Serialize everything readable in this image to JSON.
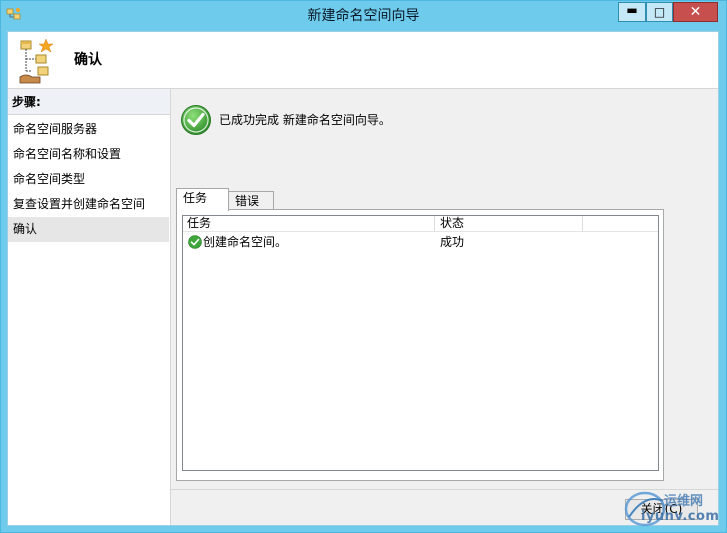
{
  "window": {
    "title": "新建命名空间向导",
    "controls": {
      "minimize": "▬",
      "maximize": "□",
      "close": "✕"
    }
  },
  "header": {
    "title": "确认"
  },
  "sidebar": {
    "heading": "步骤:",
    "items": [
      {
        "label": "命名空间服务器"
      },
      {
        "label": "命名空间名称和设置"
      },
      {
        "label": "命名空间类型"
      },
      {
        "label": "复查设置并创建命名空间"
      },
      {
        "label": "确认",
        "current": true
      }
    ]
  },
  "main": {
    "success_message": "已成功完成 新建命名空间向导。",
    "tabs": [
      {
        "label": "任务",
        "active": true
      },
      {
        "label": "错误",
        "active": false
      }
    ],
    "table": {
      "columns": [
        "任务",
        "状态"
      ],
      "rows": [
        {
          "task": "创建命名空间。",
          "status": "成功",
          "icon": "success-check-icon"
        }
      ]
    }
  },
  "footer": {
    "close_label": "关闭(C)"
  },
  "watermark": {
    "line1": "运维网",
    "line2": "iyunv.com"
  },
  "colors": {
    "titlebar": "#6ecbeb",
    "close_button": "#c7504e",
    "success_green": "#3ea63a"
  }
}
